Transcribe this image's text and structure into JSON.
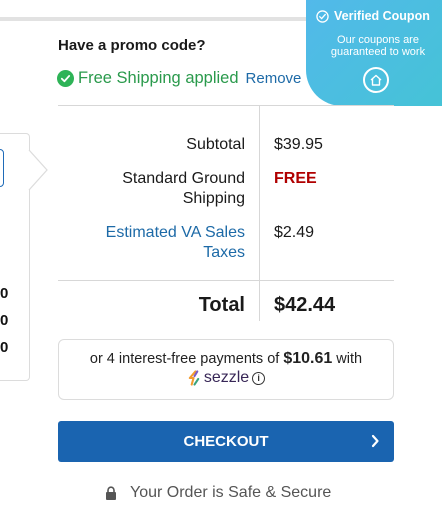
{
  "promo": {
    "title": "Have a promo code?",
    "applied_text": "Free Shipping applied",
    "remove_label": "Remove"
  },
  "badge": {
    "title": "Verified Coupon",
    "subtitle": "Our coupons are guaranteed to work",
    "icon": "home-circle-icon"
  },
  "left_panel": {
    "digits": [
      "0",
      "0",
      "0"
    ]
  },
  "totals": {
    "subtotal_label": "Subtotal",
    "subtotal_value": "$39.95",
    "shipping_label": "Standard Ground Shipping",
    "shipping_value": "FREE",
    "tax_label": "Estimated VA Sales Taxes",
    "tax_value": "$2.49",
    "total_label": "Total",
    "total_value": "$42.44"
  },
  "sezzle": {
    "text_before": "or 4 interest-free payments of",
    "amount": "$10.61",
    "text_after": "with",
    "brand": "sezzle",
    "info": "i"
  },
  "checkout": {
    "label": "CHECKOUT",
    "arrow": "›"
  },
  "secure": {
    "text": "Your Order is Safe & Secure"
  },
  "colors": {
    "accent": "#1a64b0",
    "success": "#2eb357",
    "free": "#b00000",
    "link": "#1d6aa7",
    "badge": "#4bbde2"
  }
}
